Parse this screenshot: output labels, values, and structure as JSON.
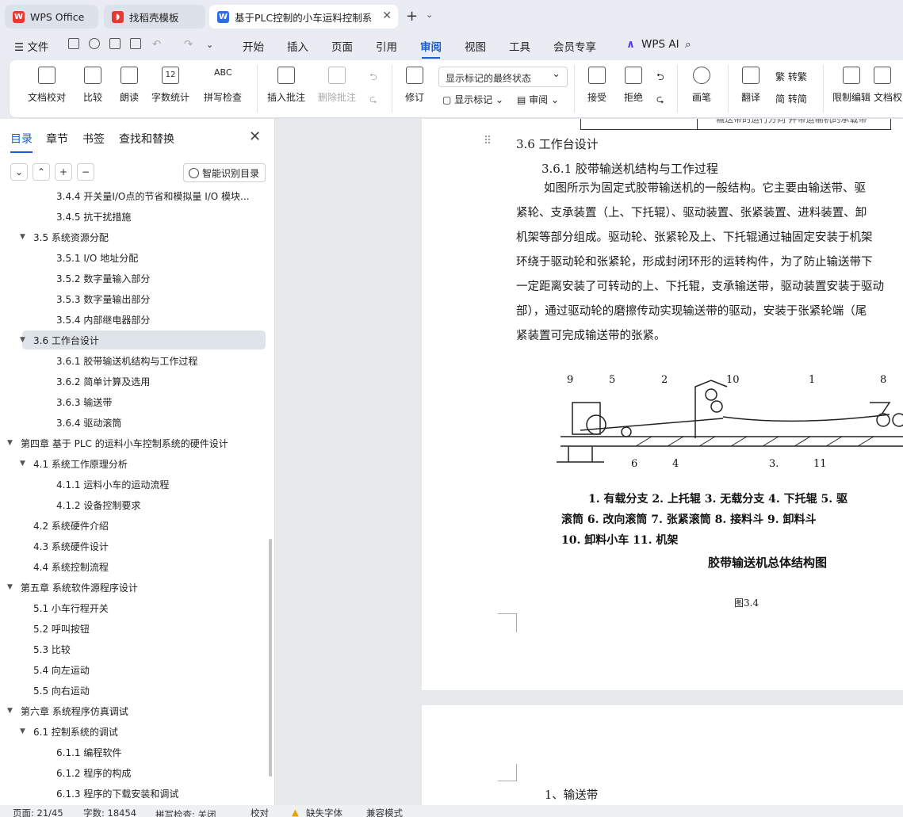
{
  "tabs": [
    {
      "label": "WPS Office",
      "icon": "wps-logo-icon"
    },
    {
      "label": "找稻壳模板",
      "icon": "docer-icon"
    },
    {
      "label": "基于PLC控制的小车运料控制系",
      "icon": "writer-doc-icon"
    }
  ],
  "menu": {
    "file": "文件",
    "items": [
      "开始",
      "插入",
      "页面",
      "引用",
      "审阅",
      "视图",
      "工具",
      "会员专享"
    ],
    "active": "审阅",
    "ai": "WPS AI"
  },
  "ribbon": {
    "doc_proof": "文档校对",
    "compare": "比较",
    "read": "朗读",
    "word_count": "字数统计",
    "word_count_icon_text": "12",
    "spell_check": "拼写检查",
    "spell_icon_text": "ABC",
    "insert_comment": "插入批注",
    "delete_comment": "删除批注",
    "revise": "修订",
    "markup_state": "显示标记的最终状态",
    "show_markup": "显示标记",
    "review": "审阅",
    "accept": "接受",
    "reject": "拒绝",
    "pen": "画笔",
    "translate": "翻译",
    "to_trad": "转繁",
    "to_simp": "转简",
    "restrict": "限制编辑",
    "doc_rights": "文档权"
  },
  "sidebar": {
    "tabs": [
      "目录",
      "章节",
      "书签",
      "查找和替换"
    ],
    "smart_toc": "智能识别目录",
    "toc": [
      {
        "text": "3.4.4 开关量I/O点的节省和模拟量 I/O 模块...",
        "level": 3
      },
      {
        "text": "3.4.5 抗干扰措施",
        "level": 3
      },
      {
        "text": "3.5  系统资源分配",
        "level": 2,
        "arrow": true
      },
      {
        "text": "3.5.1 I/O 地址分配",
        "level": 3
      },
      {
        "text": "3.5.2  数字量输入部分",
        "level": 3
      },
      {
        "text": "3.5.3  数字量输出部分",
        "level": 3
      },
      {
        "text": "3.5.4  内部继电器部分",
        "level": 3
      },
      {
        "text": "3.6  工作台设计",
        "level": 2,
        "arrow": true,
        "active": true
      },
      {
        "text": "3.6.1 胶带输送机结构与工作过程",
        "level": 3
      },
      {
        "text": "3.6.2 简单计算及选用",
        "level": 3
      },
      {
        "text": "3.6.3  输送带",
        "level": 3
      },
      {
        "text": "3.6.4 驱动滚筒",
        "level": 3
      },
      {
        "text": "第四章  基于 PLC 的运料小车控制系统的硬件设计",
        "level": 1,
        "arrow": true
      },
      {
        "text": "4.1  系统工作原理分析",
        "level": 2,
        "arrow": true
      },
      {
        "text": "4.1.1  运料小车的运动流程",
        "level": 3
      },
      {
        "text": "4.1.2 设备控制要求",
        "level": 3
      },
      {
        "text": "4.2  系统硬件介绍",
        "level": 2
      },
      {
        "text": "4.3  系统硬件设计",
        "level": 2
      },
      {
        "text": "4.4  系统控制流程",
        "level": 2
      },
      {
        "text": "第五章  系统软件源程序设计",
        "level": 1,
        "arrow": true
      },
      {
        "text": "5.1  小车行程开关",
        "level": 2
      },
      {
        "text": "5.2  呼叫按钮",
        "level": 2
      },
      {
        "text": "5.3  比较",
        "level": 2
      },
      {
        "text": "5.4  向左运动",
        "level": 2
      },
      {
        "text": "5.5  向右运动",
        "level": 2
      },
      {
        "text": "第六章  系统程序仿真调试",
        "level": 1,
        "arrow": true
      },
      {
        "text": "6.1  控制系统的调试",
        "level": 2,
        "arrow": true
      },
      {
        "text": "6.1.1 编程软件",
        "level": 3
      },
      {
        "text": "6.1.2  程序的构成",
        "level": 3
      },
      {
        "text": "6.1.3  程序的下载安装和调试",
        "level": 3
      }
    ]
  },
  "document": {
    "table_fragment": "输送带的运行方向   并带运输机的承载带",
    "h2": "3.6 工作台设计",
    "h3": "3.6.1 胶带输送机结构与工作过程",
    "para": [
      "如图所示为固定式胶带输送机的一般结构。它主要由输送带、驱",
      "紧轮、支承装置（上、下托辊）、驱动装置、张紧装置、进料装置、卸",
      "机架等部分组成。驱动轮、张紧轮及上、下托辊通过轴固定安装于机架",
      "环绕于驱动轮和张紧轮，形成封闭环形的运转构件，为了防止输送带下",
      "一定距离安装了可转动的上、下托辊，支承输送带，驱动装置安装于驱动",
      "部），通过驱动轮的磨擦传动实现输送带的驱动，安装于张紧轮端（尾",
      "紧装置可完成输送带的张紧。"
    ],
    "figure_labels_top": [
      "9",
      "5",
      "2",
      "10",
      "1",
      "8"
    ],
    "figure_labels_bottom": [
      "6",
      "4",
      "3.",
      "11"
    ],
    "legend": [
      "1. 有载分支   2. 上托辊   3. 无载分支   4. 下托辊   5. 驱",
      "滚筒   6. 改向滚筒   7. 张紧滚筒   8. 接料斗   9. 卸料斗",
      "10. 卸料小车   11. 机架"
    ],
    "figure_title": "胶带输送机总体结构图",
    "figure_caption": "图3.4",
    "next_page_text": "1、输送带"
  },
  "status": {
    "page": "页面: 21/45",
    "words": "字数: 18454",
    "spell": "拼写检查: 关闭",
    "proof": "校对",
    "missing_font": "缺失字体",
    "compat": "兼容模式"
  },
  "colors": {
    "accent": "#1a5fd6",
    "wps_red": "#e63a2e",
    "active_toc_bg": "#dfe3ea"
  }
}
